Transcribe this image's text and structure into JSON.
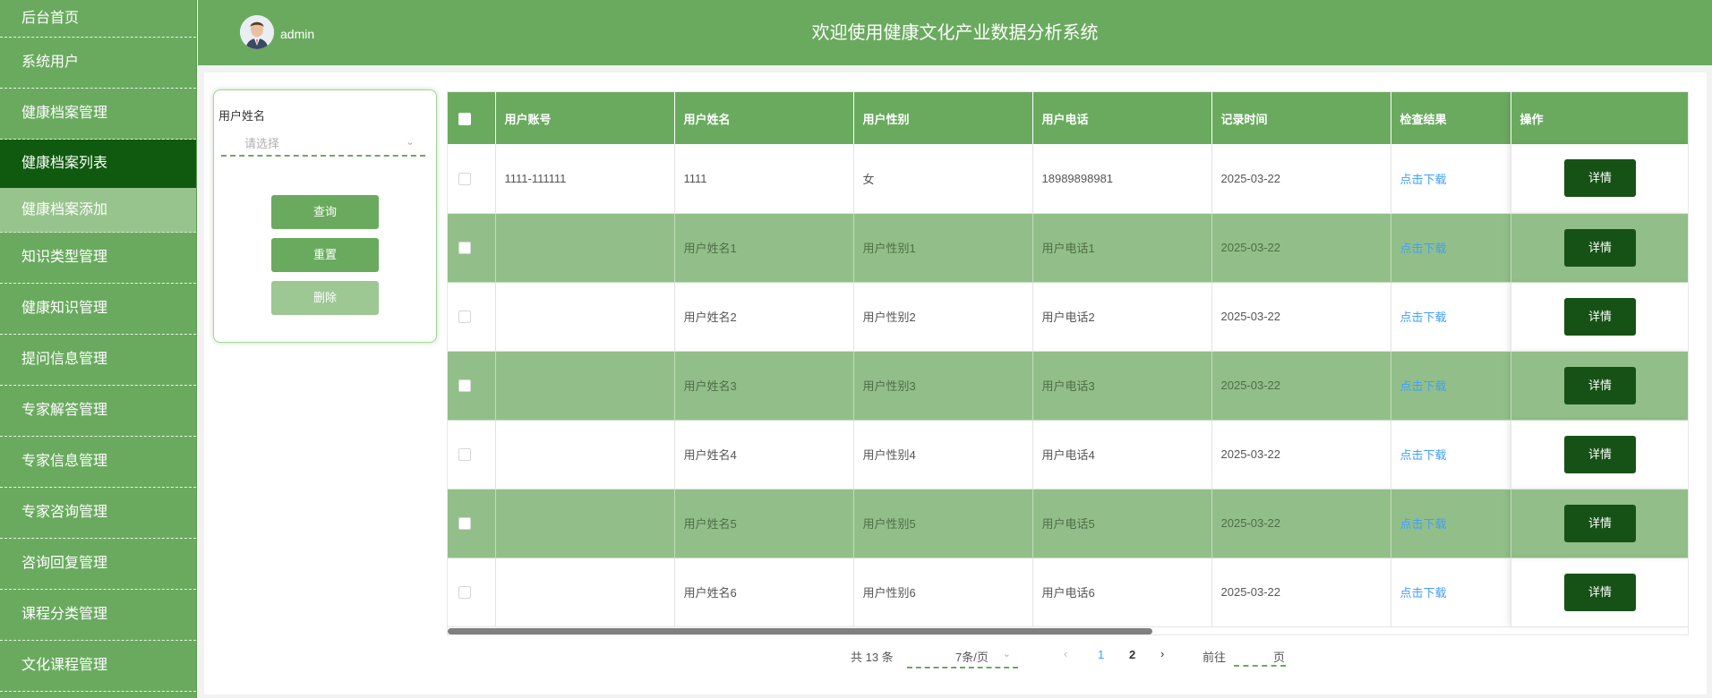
{
  "sidebar": {
    "items": [
      {
        "label": "后台首页"
      },
      {
        "label": "系统用户"
      },
      {
        "label": "健康档案管理"
      },
      {
        "label": "健康档案列表"
      },
      {
        "label": "健康档案添加"
      },
      {
        "label": "知识类型管理"
      },
      {
        "label": "健康知识管理"
      },
      {
        "label": "提问信息管理"
      },
      {
        "label": "专家解答管理"
      },
      {
        "label": "专家信息管理"
      },
      {
        "label": "专家咨询管理"
      },
      {
        "label": "咨询回复管理"
      },
      {
        "label": "课程分类管理"
      },
      {
        "label": "文化课程管理"
      }
    ]
  },
  "header": {
    "username": "admin",
    "title": "欢迎使用健康文化产业数据分析系统"
  },
  "search": {
    "field_label": "用户姓名",
    "placeholder": "请选择",
    "query_label": "查询",
    "reset_label": "重置",
    "delete_label": "删除"
  },
  "table": {
    "headers": [
      "用户账号",
      "用户姓名",
      "用户性别",
      "用户电话",
      "记录时间",
      "检查结果",
      "操作"
    ],
    "rows": [
      {
        "account": "1111-111111",
        "name": "1111",
        "gender": "女",
        "phone": "18989898981",
        "time": "2025-03-22",
        "result": "点击下载",
        "action": "详情"
      },
      {
        "account": "",
        "name": "用户姓名1",
        "gender": "用户性别1",
        "phone": "用户电话1",
        "time": "2025-03-22",
        "result": "点击下载",
        "action": "详情"
      },
      {
        "account": "",
        "name": "用户姓名2",
        "gender": "用户性别2",
        "phone": "用户电话2",
        "time": "2025-03-22",
        "result": "点击下载",
        "action": "详情"
      },
      {
        "account": "",
        "name": "用户姓名3",
        "gender": "用户性别3",
        "phone": "用户电话3",
        "time": "2025-03-22",
        "result": "点击下载",
        "action": "详情"
      },
      {
        "account": "",
        "name": "用户姓名4",
        "gender": "用户性别4",
        "phone": "用户电话4",
        "time": "2025-03-22",
        "result": "点击下载",
        "action": "详情"
      },
      {
        "account": "",
        "name": "用户姓名5",
        "gender": "用户性别5",
        "phone": "用户电话5",
        "time": "2025-03-22",
        "result": "点击下载",
        "action": "详情"
      },
      {
        "account": "",
        "name": "用户姓名6",
        "gender": "用户性别6",
        "phone": "用户电话6",
        "time": "2025-03-22",
        "result": "点击下载",
        "action": "详情"
      }
    ]
  },
  "pagination": {
    "total": "共 13 条",
    "page_size": "7条/页",
    "pages": [
      "1",
      "2"
    ],
    "goto_label": "前往",
    "page_label": "页"
  },
  "colors": {
    "primary_green": "#6aaa5f",
    "active_menu": "#0f5a0f",
    "striped_row": "#92bf89",
    "detail_button": "#165216",
    "link": "#409eff"
  }
}
